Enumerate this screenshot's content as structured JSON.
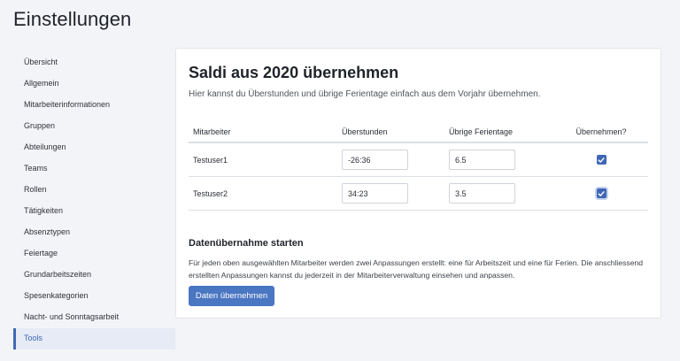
{
  "page": {
    "title": "Einstellungen"
  },
  "sidebar": {
    "items": [
      {
        "label": "Übersicht"
      },
      {
        "label": "Allgemein"
      },
      {
        "label": "Mitarbeiterinformationen"
      },
      {
        "label": "Gruppen"
      },
      {
        "label": "Abteilungen"
      },
      {
        "label": "Teams"
      },
      {
        "label": "Rollen"
      },
      {
        "label": "Tätigkeiten"
      },
      {
        "label": "Absenztypen"
      },
      {
        "label": "Feiertage"
      },
      {
        "label": "Grundarbeitszeiten"
      },
      {
        "label": "Spesenkategorien"
      },
      {
        "label": "Nacht- und Sonntagsarbeit"
      },
      {
        "label": "Tools",
        "active": true
      }
    ]
  },
  "card": {
    "title": "Saldi aus 2020 übernehmen",
    "subtitle": "Hier kannst du Überstunden und übrige Ferientage einfach aus dem Vorjahr übernehmen."
  },
  "table": {
    "headers": {
      "employee": "Mitarbeiter",
      "overtime": "Überstunden",
      "vacation": "Übrige Ferientage",
      "take_over": "Übernehmen?"
    },
    "rows": [
      {
        "employee": "Testuser1",
        "overtime": "-26:36",
        "vacation": "6.5",
        "checked": true
      },
      {
        "employee": "Testuser2",
        "overtime": "34:23",
        "vacation": "3.5",
        "checked": true
      }
    ]
  },
  "transfer": {
    "title": "Datenübernahme starten",
    "description": "Für jeden oben ausgewählten Mitarbeiter werden zwei Anpassungen erstellt: eine für Arbeitszeit und eine für Ferien. Die anschliessend erstellten Anpassungen kannst du jederzeit in der Mitarbeiterverwaltung einsehen und anpassen.",
    "button_label": "Daten übernehmen"
  },
  "colors": {
    "accent": "#4a76c2",
    "active_nav_bg": "#e6ebf5",
    "page_bg": "#f3f4f7"
  },
  "icons": {
    "checkbox": "checkmark-icon"
  }
}
